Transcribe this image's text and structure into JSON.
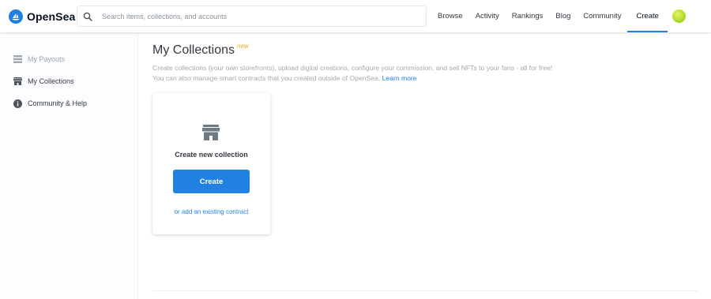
{
  "header": {
    "brand": "OpenSea",
    "search_placeholder": "Search items, collections, and accounts",
    "nav": [
      {
        "label": "Browse"
      },
      {
        "label": "Activity"
      },
      {
        "label": "Rankings"
      },
      {
        "label": "Blog"
      },
      {
        "label": "Community"
      },
      {
        "label": "Create",
        "active": true
      }
    ]
  },
  "sidebar": {
    "items": [
      {
        "label": "My Payouts",
        "icon": "list-icon",
        "muted": true
      },
      {
        "label": "My Collections",
        "icon": "storefront-icon"
      },
      {
        "label": "Community & Help",
        "icon": "info-icon"
      }
    ]
  },
  "main": {
    "title": "My Collections",
    "badge": "new",
    "description_1": "Create collections (your own storefronts), upload digital creations, configure your commission, and sell NFTs to your fans - all for free!",
    "description_2": "You can also manage smart contracts that you created outside of OpenSea.",
    "learn_more": "Learn more",
    "card": {
      "icon": "storefront-icon",
      "heading": "Create new collection",
      "button": "Create",
      "link": "or add an existing contract"
    }
  },
  "colors": {
    "accent": "#2081e2",
    "badge": "#f5a623",
    "text": "#353840",
    "muted": "#a4a9ae"
  }
}
